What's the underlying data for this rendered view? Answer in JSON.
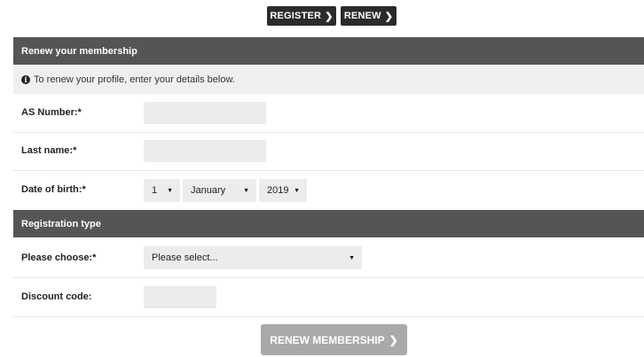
{
  "nav": {
    "register_label": "REGISTER",
    "renew_label": "RENEW",
    "chevron": "❯"
  },
  "renew_section": {
    "title": "Renew your membership",
    "info_text": "To renew your profile, enter your details below.",
    "info_icon": "i"
  },
  "fields": {
    "as_number": {
      "label": "AS Number:*",
      "value": ""
    },
    "last_name": {
      "label": "Last name:*",
      "value": ""
    },
    "dob": {
      "label": "Date of birth:*",
      "day": "1",
      "month": "January",
      "year": "2019"
    }
  },
  "registration_section": {
    "title": "Registration type"
  },
  "registration": {
    "choose": {
      "label": "Please choose:*",
      "selected": "Please select..."
    },
    "discount": {
      "label": "Discount code:",
      "value": ""
    }
  },
  "submit": {
    "label": "RENEW MEMBERSHIP",
    "chevron": "❯"
  },
  "caret": "▼",
  "colors": {
    "header_bg": "#555555",
    "nav_bg": "#2b2b2b",
    "input_bg": "#ececec",
    "info_bg": "#efefef",
    "submit_bg": "#a9a9a9"
  }
}
